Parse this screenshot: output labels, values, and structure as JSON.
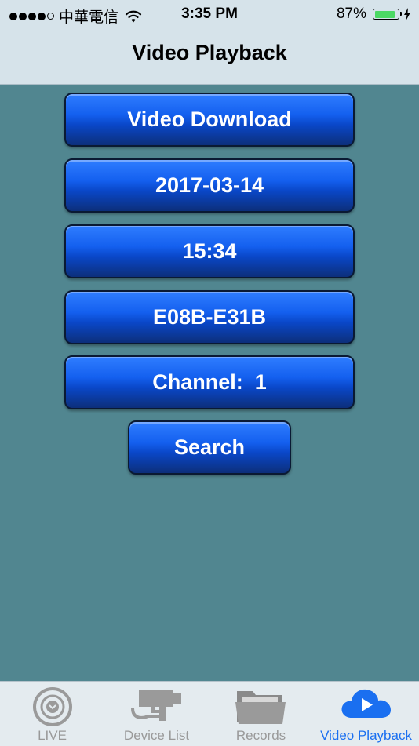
{
  "status_bar": {
    "carrier": "中華電信",
    "time": "3:35 PM",
    "battery_percent": "87%",
    "battery_level": 0.87,
    "battery_color": "#4cd964"
  },
  "nav": {
    "title": "Video Playback"
  },
  "buttons": {
    "download": "Video Download",
    "date": "2017-03-14",
    "time": "15:34",
    "range": "E08B-E31B",
    "channel": "Channel:  1",
    "search": "Search"
  },
  "tabs": [
    {
      "label": "LIVE",
      "icon": "live-icon",
      "active": false
    },
    {
      "label": "Device List",
      "icon": "camera-icon",
      "active": false
    },
    {
      "label": "Records",
      "icon": "folder-icon",
      "active": false
    },
    {
      "label": "Video Playback",
      "icon": "cloud-play-icon",
      "active": true
    }
  ],
  "colors": {
    "background": "#518690",
    "button_blue": "#1460ef",
    "active_tab": "#1a6ff0",
    "inactive_tab": "#999999"
  }
}
